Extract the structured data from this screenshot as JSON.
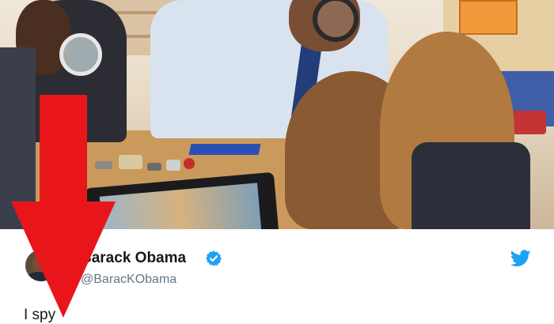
{
  "tweet": {
    "author_name": "Barack Obama",
    "handle": "@BaracKObama",
    "text": "I spy",
    "verified": true,
    "platform_icon": "twitter-bird-icon",
    "verified_icon": "verified-badge-icon"
  },
  "photo": {
    "description_icon": "photo-image"
  },
  "overlay": {
    "arrow_icon": "red-down-arrow-icon",
    "arrow_color": "#e8161b"
  },
  "colors": {
    "twitter_blue": "#1da1f2",
    "name_text": "#14171a",
    "handle_text": "#657786"
  }
}
